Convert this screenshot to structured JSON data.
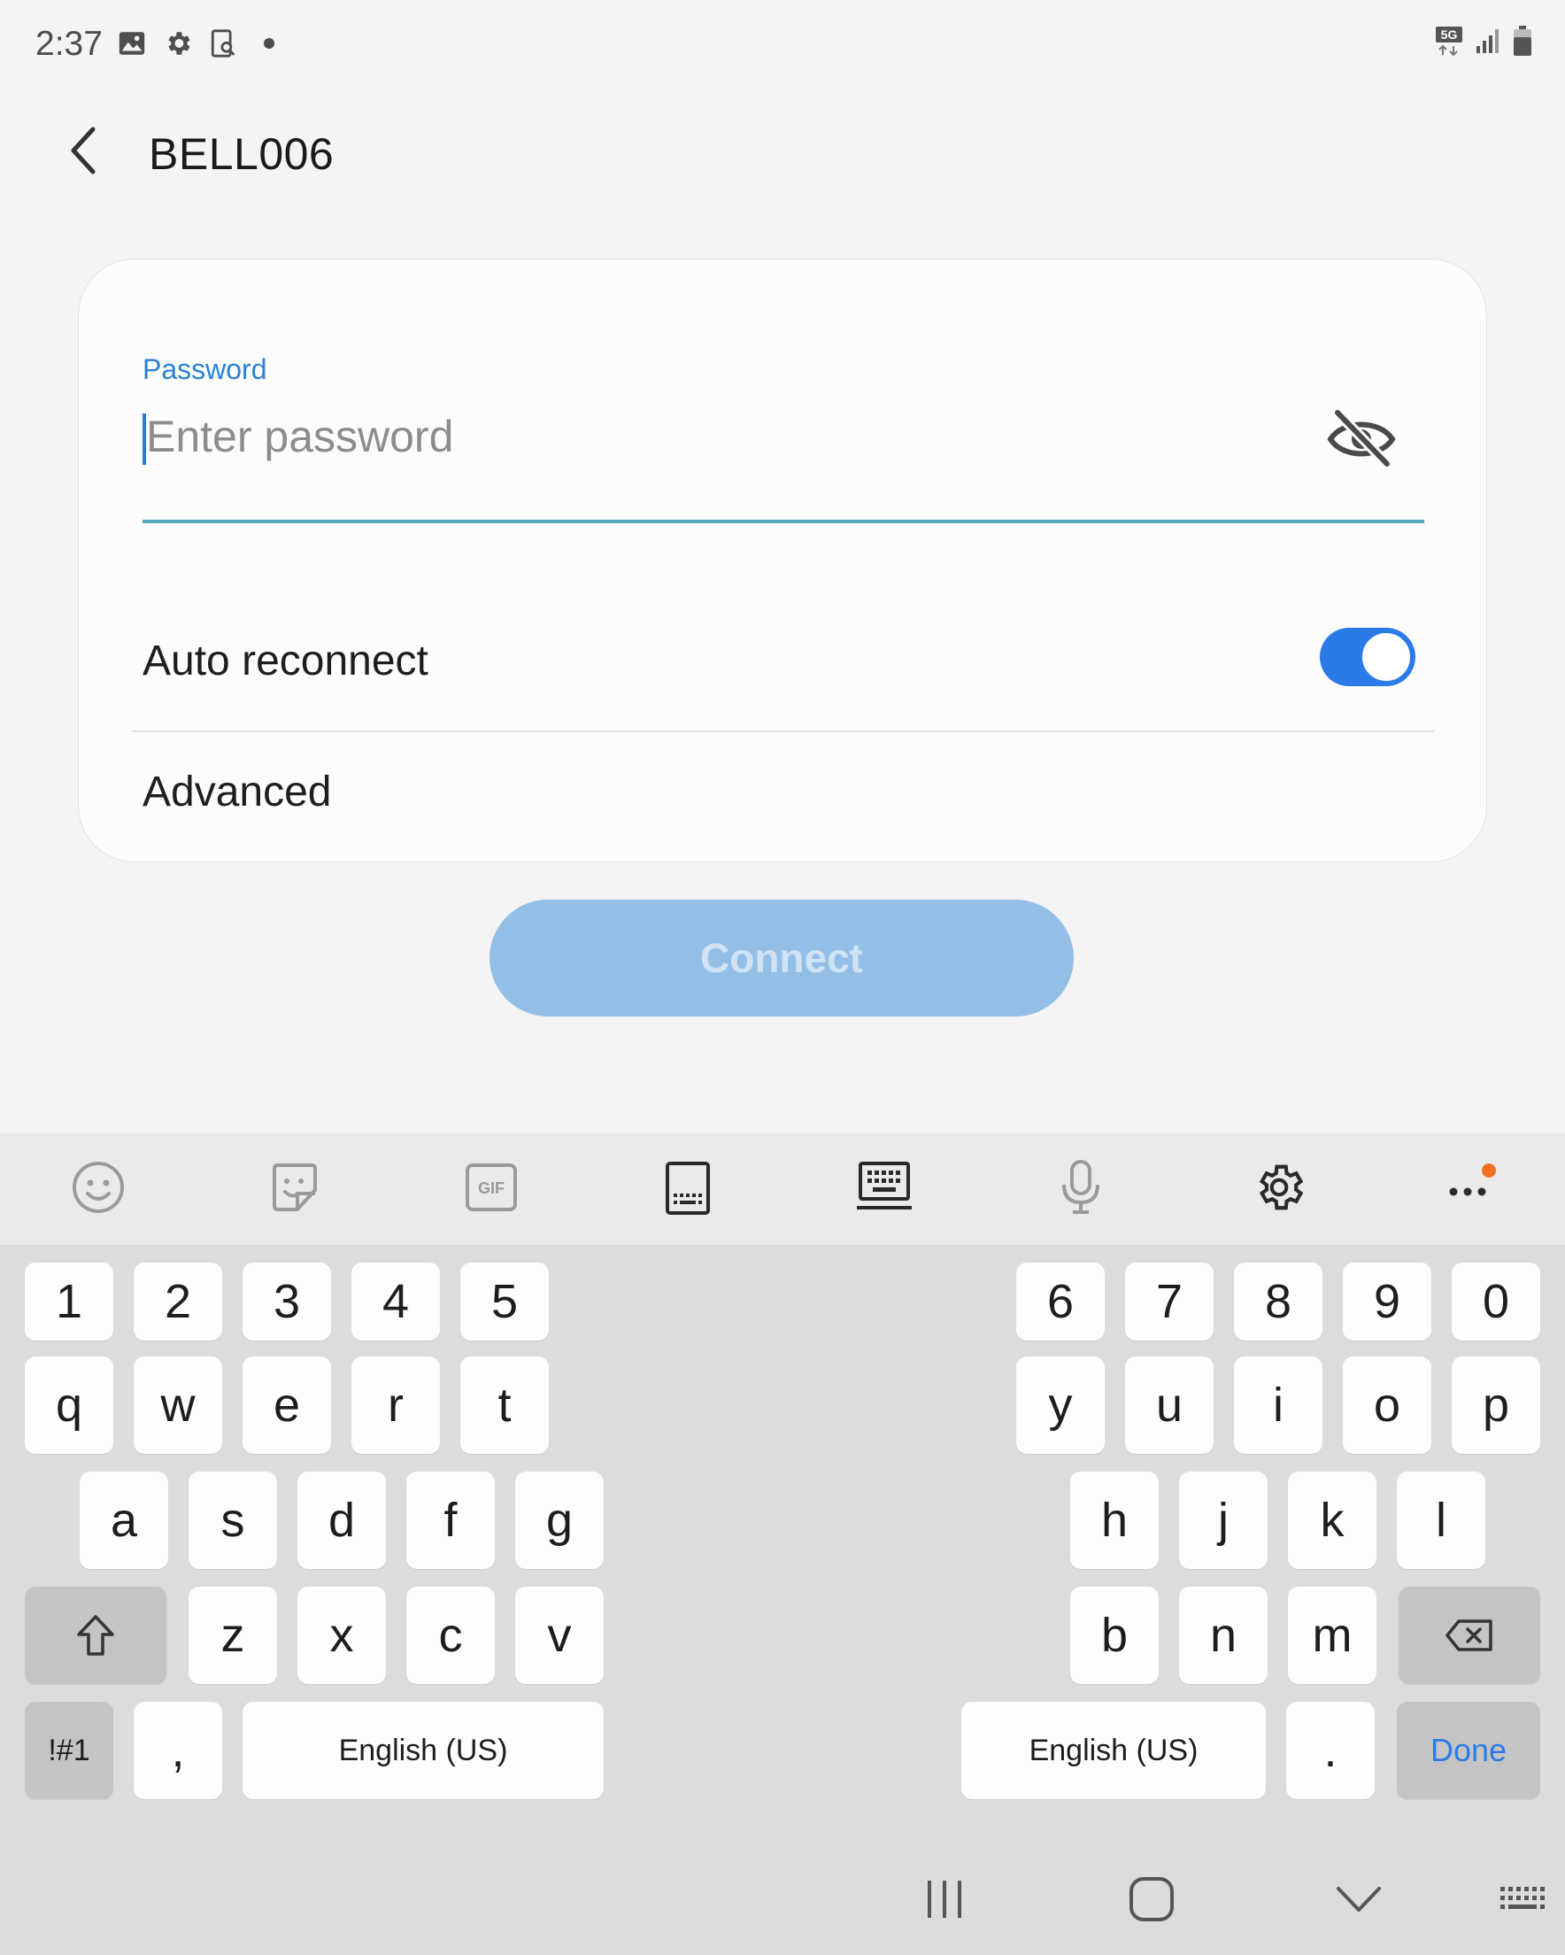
{
  "status_bar": {
    "time": "2:37",
    "left_icons": [
      "image-icon",
      "gear-icon",
      "screen-search-icon",
      "dot-icon"
    ],
    "right_icons": [
      "5g-data-icon",
      "signal-bars-icon",
      "battery-icon"
    ]
  },
  "header": {
    "title": "BELL006",
    "back_icon": "chevron-left-icon"
  },
  "form": {
    "password_label": "Password",
    "password_placeholder": "Enter password",
    "password_value": "",
    "visibility_icon": "eye-off-icon",
    "auto_reconnect_label": "Auto reconnect",
    "auto_reconnect_on": true,
    "advanced_label": "Advanced",
    "connect_label": "Connect"
  },
  "keyboard": {
    "toolbar_icons": [
      "emoji-icon",
      "sticker-icon",
      "gif-icon",
      "keyboard-mode-icon",
      "keyboard-layout-icon",
      "microphone-icon",
      "settings-icon",
      "more-icon"
    ],
    "gif_label": "GIF",
    "left_half": {
      "row1": [
        "1",
        "2",
        "3",
        "4",
        "5"
      ],
      "row2": [
        "q",
        "w",
        "e",
        "r",
        "t"
      ],
      "row3": [
        "a",
        "s",
        "d",
        "f",
        "g"
      ],
      "row4": [
        "z",
        "x",
        "c",
        "v"
      ],
      "symbols_label": "!#1",
      "comma_label": ",",
      "space_label": "English (US)"
    },
    "right_half": {
      "row1": [
        "6",
        "7",
        "8",
        "9",
        "0"
      ],
      "row2": [
        "y",
        "u",
        "i",
        "o",
        "p"
      ],
      "row3": [
        "h",
        "j",
        "k",
        "l"
      ],
      "row4": [
        "b",
        "n",
        "m"
      ],
      "space_label": "English (US)",
      "period_label": ".",
      "done_label": "Done"
    }
  },
  "nav_bar": {
    "icons": [
      "recents-icon",
      "home-icon",
      "hide-keyboard-icon",
      "keyboard-switch-icon"
    ]
  },
  "colors": {
    "accent": "#2a7be8",
    "label_blue": "#2a82d4",
    "connect_disabled": "#93bfe6",
    "background": "#f4f4f4",
    "keyboard_bg": "#dcdcdc",
    "notification_dot": "#f36f21"
  }
}
